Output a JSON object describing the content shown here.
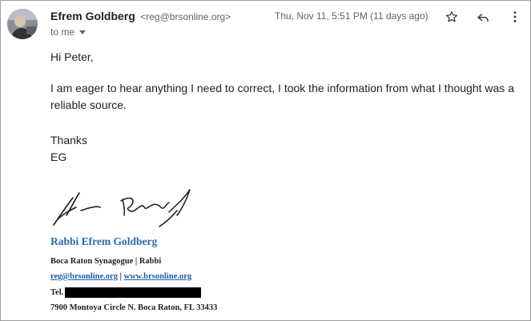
{
  "header": {
    "sender_name": "Efrem Goldberg",
    "sender_email": "<reg@brsonline.org>",
    "date": "Thu, Nov 11, 5:51 PM (11 days ago)",
    "to_label": "to me"
  },
  "icons": {
    "avatar": "avatar-photo",
    "star": "star-icon",
    "reply": "reply-icon",
    "more": "more-vert-icon",
    "caret": "chevron-down-icon"
  },
  "body": {
    "greeting": "Hi Peter,",
    "paragraph": "I am eager to hear anything I need to correct, I took the information from what I thought was a reliable source.",
    "closing": "Thanks",
    "initials": "EG"
  },
  "signature": {
    "name": "Rabbi Efrem Goldberg",
    "org": "Boca Raton Synagogue | Rabbi",
    "email_link": "reg@brsonline.org",
    "separator": "|",
    "web_link": "www.brsonline.org",
    "tel_label": "Tel. ",
    "address": "7900 Montoya Circle N. Boca Raton, FL 33433"
  },
  "colors": {
    "signature_name": "#2e6aa8",
    "link": "#1a5fa8",
    "muted": "#5f6368"
  }
}
